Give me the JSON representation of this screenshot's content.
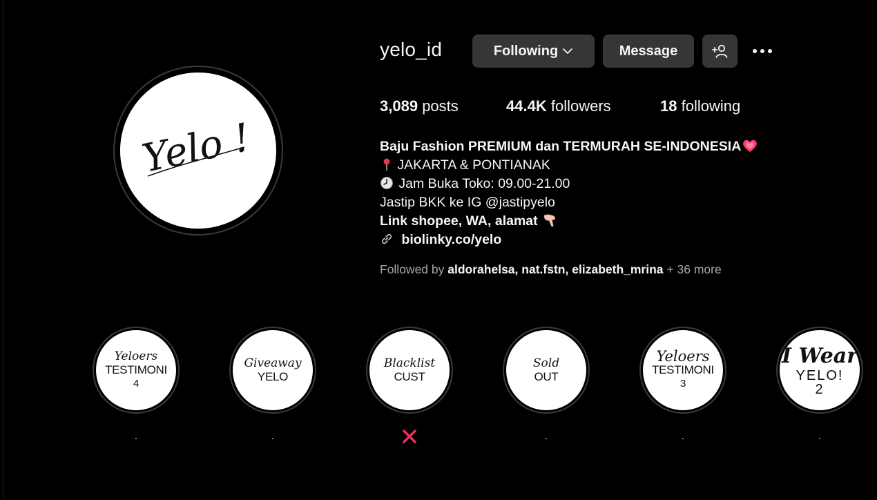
{
  "profile": {
    "username": "yelo_id",
    "avatar_text": "Yelo !"
  },
  "actions": {
    "following_label": "Following",
    "message_label": "Message",
    "add_user_icon": "add-person-icon",
    "more_icon": "more-horizontal-icon"
  },
  "stats": {
    "posts_count": "3,089",
    "posts_label": "posts",
    "followers_count": "44.4K",
    "followers_label": "followers",
    "following_count": "18",
    "following_label": "following"
  },
  "bio": {
    "line1": "Baju Fashion PREMIUM dan TERMURAH SE-INDONESIA",
    "line2": "JAKARTA & PONTIANAK",
    "line3": "Jam Buka Toko: 09.00-21.00",
    "line4": "Jastip BKK ke IG @jastipyelo",
    "line5": "Link shopee, WA, alamat",
    "link": "biolinky.co/yelo"
  },
  "followed_by": {
    "prefix": "Followed by",
    "user1": "aldorahelsa",
    "user2": "nat.fstn",
    "user3": "elizabeth_mrina",
    "suffix": "+ 36 more",
    "sep": ","
  },
  "highlights": [
    {
      "script": "Yeloers",
      "text": "TESTIMONI",
      "num": "4",
      "label": "."
    },
    {
      "script": "Giveaway",
      "text": "YELO",
      "num": "",
      "label": "."
    },
    {
      "script": "Blacklist",
      "text": "CUST",
      "num": "",
      "label": ""
    },
    {
      "script": "Sold",
      "text": "OUT",
      "num": "",
      "label": "."
    },
    {
      "script": "Yeloers",
      "text": "TESTIMONI",
      "num": "3",
      "label": "."
    },
    {
      "script": "I Wear",
      "text": "YELO!",
      "num": "2",
      "label": "."
    }
  ],
  "colors": {
    "background": "#000000",
    "button": "#363636",
    "muted": "#a8a8a8",
    "heart": "#ff3b6b",
    "cross": "#e8335a"
  }
}
